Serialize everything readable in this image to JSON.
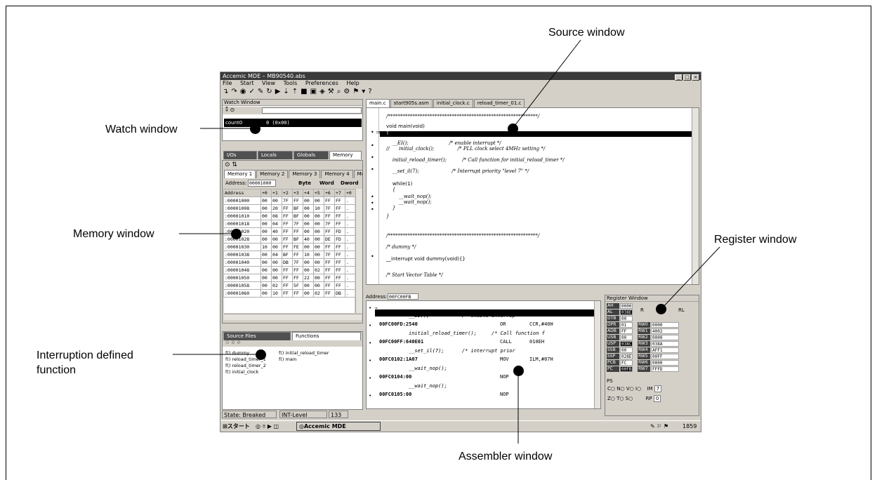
{
  "callouts": {
    "source_window": "Source window",
    "watch_window": "Watch window",
    "memory_window": "Memory window",
    "register_window": "Register window",
    "interruption_line1": "Interruption defined",
    "interruption_line2": "function",
    "assembler_window": "Assembler window"
  },
  "app": {
    "title": "Accemic MDE – MB90540.abs",
    "menu": [
      "File",
      "Start",
      "View",
      "Tools",
      "Preferences",
      "Help"
    ],
    "toolbar_icons": [
      "step-into-icon",
      "step-over-icon",
      "breakpoint-icon",
      "watch-icon",
      "edit-icon",
      "reset-icon",
      "run-icon",
      "step-icon",
      "step-out-icon",
      "stop-icon",
      "save-icon",
      "erase-icon",
      "build-icon",
      "find-icon",
      "settings-icon",
      "bookmark-icon",
      "options-icon",
      "help-icon"
    ]
  },
  "watch": {
    "title": "Watch Window",
    "row_name": "count0",
    "row_value": "0 (0x00)"
  },
  "view_tabs": [
    "I/Os",
    "Locals",
    "Globals",
    "Memory"
  ],
  "memory": {
    "tabs": [
      "Memory 1",
      "Memory 2",
      "Memory 3",
      "Memory 4",
      "Me"
    ],
    "address_label": "Address:",
    "address_value": "00001000",
    "modes": [
      "Byte",
      "Word",
      "Dword"
    ],
    "headers": [
      "Address",
      "+0",
      "+1",
      "+2",
      "+3",
      "+4",
      "+5",
      "+6",
      "+7",
      "+0"
    ],
    "rows": [
      [
        ":00001000",
        "00",
        "00",
        "7F",
        "FF",
        "00",
        "00",
        "FF",
        "FF",
        "."
      ],
      [
        ":00001008",
        "00",
        "20",
        "FF",
        "BF",
        "00",
        "10",
        "7F",
        "FF",
        "."
      ],
      [
        ":00001010",
        "00",
        "08",
        "FF",
        "BF",
        "00",
        "00",
        "FF",
        "FF",
        "."
      ],
      [
        ":00001018",
        "00",
        "04",
        "FF",
        "7F",
        "00",
        "00",
        "7F",
        "FF",
        "."
      ],
      [
        ":00001020",
        "00",
        "40",
        "FF",
        "FF",
        "00",
        "00",
        "FF",
        "FD",
        "."
      ],
      [
        ":00001028",
        "00",
        "00",
        "FF",
        "BF",
        "40",
        "00",
        "DE",
        "FD",
        "."
      ],
      [
        ":00001030",
        "10",
        "00",
        "FF",
        "FE",
        "00",
        "00",
        "FF",
        "FF",
        "."
      ],
      [
        ":00001038",
        "00",
        "04",
        "BF",
        "FF",
        "10",
        "00",
        "7F",
        "FF",
        "."
      ],
      [
        ":00001040",
        "00",
        "00",
        "DB",
        "7F",
        "00",
        "00",
        "FF",
        "FF",
        "."
      ],
      [
        ":00001048",
        "00",
        "00",
        "FF",
        "FF",
        "00",
        "02",
        "FF",
        "FF",
        "."
      ],
      [
        ":00001050",
        "00",
        "00",
        "FF",
        "FF",
        "22",
        "00",
        "FF",
        "FF",
        "."
      ],
      [
        ":00001058",
        "00",
        "02",
        "FF",
        "5F",
        "00",
        "00",
        "FF",
        "FF",
        "."
      ],
      [
        ":00001060",
        "00",
        "10",
        "FF",
        "FF",
        "00",
        "02",
        "FF",
        "DB",
        "."
      ]
    ]
  },
  "files_panel": {
    "tabs": [
      "Source Files",
      "Functions"
    ],
    "functions_col1": [
      "dummy",
      "reload_timer_1",
      "reload_timer_2",
      "initial_clock"
    ],
    "functions_col2": [
      "initial_reload_timer",
      "main"
    ]
  },
  "source": {
    "tabs": [
      "main.c",
      "start905s.asm",
      "initial_clock.c",
      "reload_timer_01.c"
    ],
    "lines": [
      "/*************************************************************/",
      "void main(void)",
      "{",
      "    __EI();                          /* enable interrupt */",
      "//      initial_clock();               /* PLL clock select 4MHz setting */",
      "    initial_reload_timer();          /* Call function for initial_reload_timer */",
      "    __set_il(7);                     /* Interrupt priority \"level 7\" */",
      "    while(1)",
      "    {",
      "        __wait_nop();",
      "        __wait_nop();",
      "    }",
      "}",
      "/*************************************************************/",
      "/* dummy */",
      "__interrupt void dummy(void){}",
      "/* Start Vector Table */"
    ]
  },
  "assembler": {
    "address_label": "Address:",
    "address_value": "00FC00FB",
    "lines": [
      {
        "addr": "00FC00FB:0800",
        "op": "LINK",
        "arg": "#00H",
        "src": ""
      },
      {
        "addr": "",
        "op": "",
        "arg": "",
        "src": "__EI();           /* enable interrup"
      },
      {
        "addr": "00FC00FD:2540",
        "op": "OR",
        "arg": "CCR,#40H",
        "src": ""
      },
      {
        "addr": "",
        "op": "",
        "arg": "",
        "src": "initial_reload_timer();     /* Call function f"
      },
      {
        "addr": "00FC00FF:640E01",
        "op": "CALL",
        "arg": "010EH",
        "src": ""
      },
      {
        "addr": "",
        "op": "",
        "arg": "",
        "src": "__set_il(7);      /* interrupt prior"
      },
      {
        "addr": "00FC0102:1A07",
        "op": "MOV",
        "arg": "ILM,#07H",
        "src": ""
      },
      {
        "addr": "",
        "op": "",
        "arg": "",
        "src": "__wait_nop();"
      },
      {
        "addr": "00FC0104:00",
        "op": "NOP",
        "arg": "",
        "src": ""
      },
      {
        "addr": "",
        "op": "",
        "arg": "",
        "src": "__wait_nop();"
      },
      {
        "addr": "00FC0105:00",
        "op": "NOP",
        "arg": "",
        "src": ""
      }
    ]
  },
  "registers": {
    "title": "Register Window",
    "left": [
      [
        "AH",
        "0000"
      ],
      [
        "AL",
        "038E"
      ],
      [
        "DTB",
        "00"
      ],
      [
        "DPR",
        "01"
      ],
      [
        "ADB",
        "FF"
      ],
      [
        "USB",
        "00"
      ],
      [
        "USP",
        "038C"
      ],
      [
        "SSB",
        "00"
      ],
      [
        "SSP",
        "028E"
      ],
      [
        "PCB",
        "FC"
      ],
      [
        "PC",
        "00FB"
      ]
    ],
    "bank_buttons": [
      "R",
      "RW",
      "RL"
    ],
    "rw": [
      [
        "RW0",
        "0000"
      ],
      [
        "RW1",
        "4002"
      ],
      [
        "RW2",
        "0000"
      ],
      [
        "RW3",
        "038A"
      ],
      [
        "RW4",
        "AFF1"
      ],
      [
        "RW5",
        "00FF"
      ],
      [
        "RW6",
        "0000"
      ],
      [
        "RW7",
        "FFFD"
      ]
    ],
    "ps_label": "PS",
    "flags_row1": [
      "C",
      "N",
      "V",
      "I"
    ],
    "ilm_label": "IM",
    "ilm_value": "7",
    "flags_row2": [
      "Z",
      "T",
      "S"
    ],
    "rp_label": "RP",
    "rp_value": "0"
  },
  "statusbar": {
    "state": "State: Breaked",
    "int_level": "INT-Level Disable",
    "count": "133"
  },
  "taskbar": {
    "start": "スタート",
    "app_button": "Accemic MDE",
    "clock": "1859"
  }
}
